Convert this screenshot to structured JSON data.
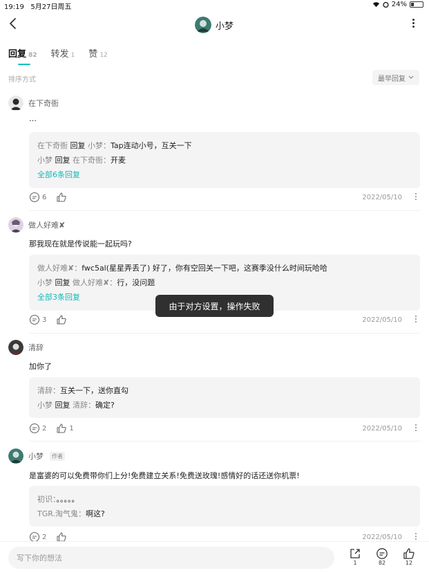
{
  "status_bar": {
    "time": "19:19",
    "date": "5月27日周五",
    "battery": "24%"
  },
  "header": {
    "title": "小梦"
  },
  "tabs": [
    {
      "label": "回复",
      "count": "82"
    },
    {
      "label": "转发",
      "count": "1"
    },
    {
      "label": "赞",
      "count": "12"
    }
  ],
  "sort": {
    "label": "排序方式",
    "value": "最早回复"
  },
  "comments": [
    {
      "name": "在下奇衙",
      "text": "…",
      "replies": [
        {
          "from": "在下奇衙",
          "verb": "回复",
          "to": "小梦：",
          "text": "Tap连动小号，互关一下"
        },
        {
          "from": "小梦",
          "verb": "回复",
          "to": "在下奇衙：",
          "text": "开麦"
        }
      ],
      "all_replies": "全部6条回复",
      "reply_count": "6",
      "like_count": "",
      "date": "2022/05/10"
    },
    {
      "name": "做人好难✘",
      "text": "那我现在就是传说能一起玩吗?",
      "replies": [
        {
          "from": "做人好难✘：",
          "verb": "",
          "to": "",
          "text": "fwc5al(星星弄丢了) 好了，你有空回关一下吧，这赛季没什么时间玩哈哈"
        },
        {
          "from": "小梦",
          "verb": "回复",
          "to": "做人好难✘：",
          "text": "行，没问题"
        }
      ],
      "all_replies": "全部3条回复",
      "reply_count": "3",
      "like_count": "",
      "date": "2022/05/10"
    },
    {
      "name": "清辞",
      "text": "加你了",
      "replies": [
        {
          "from": "清辞：",
          "verb": "",
          "to": "",
          "text": "互关一下，送你直勾"
        },
        {
          "from": "小梦",
          "verb": "回复",
          "to": "清辞：",
          "text": "确定?"
        }
      ],
      "all_replies": "",
      "reply_count": "2",
      "like_count": "1",
      "date": "2022/05/10"
    },
    {
      "name": "小梦",
      "author_tag": "作者",
      "text": "是富婆的可以免费带你们上分!免费建立关系!免费送玫瑰!感情好的话还送你机票!",
      "replies": [
        {
          "from": "初识：",
          "verb": "",
          "to": "",
          "text": "。。。。。"
        },
        {
          "from": "TGR.淘气鬼：",
          "verb": "",
          "to": "",
          "text": "啊这?"
        }
      ],
      "all_replies": "",
      "reply_count": "2",
      "like_count": "",
      "date": "2022/05/10"
    }
  ],
  "toast": "由于对方设置，操作失败",
  "bottom_bar": {
    "placeholder": "写下你的想法",
    "share_count": "1",
    "comment_count": "82",
    "like_count": "12"
  }
}
